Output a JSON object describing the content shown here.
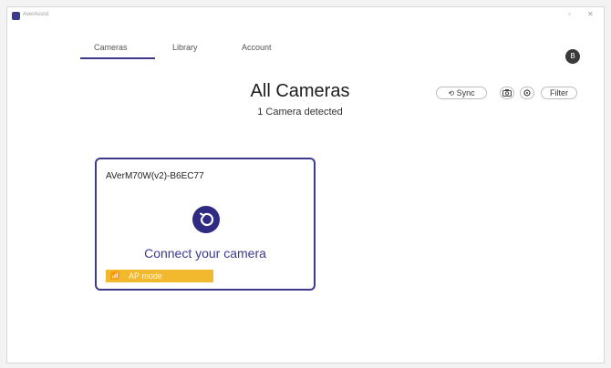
{
  "window": {
    "app_title": "AverAssist",
    "controls": {
      "minimize": "–",
      "maximize": "▫",
      "close": "✕"
    }
  },
  "nav": {
    "tabs": [
      {
        "label": "Cameras",
        "active": true
      },
      {
        "label": "Library",
        "active": false
      },
      {
        "label": "Account",
        "active": false
      }
    ],
    "avatar_initial": "B"
  },
  "header": {
    "title": "All Cameras",
    "subtitle": "1 Camera detected",
    "sync_icon": "⟲",
    "sync_label": "Sync",
    "camera_icon": "camera-icon",
    "settings_icon": "gear-icon",
    "filter_label": "Filter"
  },
  "cameras": [
    {
      "name": "AVerM70W(v2)-B6EC77",
      "action_text": "Connect your camera",
      "mode_icon": "📶",
      "mode_label": "AP mode"
    }
  ],
  "colors": {
    "accent": "#3d3a8e",
    "icon_bg": "#2f2b83",
    "badge": "#f2b92e"
  }
}
